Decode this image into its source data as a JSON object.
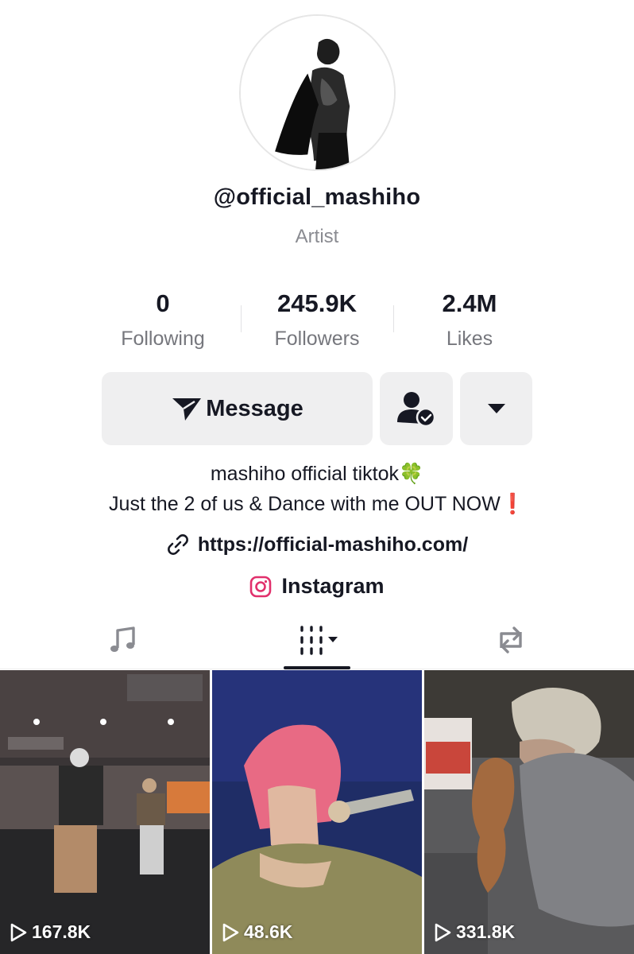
{
  "profile": {
    "username": "@official_mashiho",
    "category": "Artist"
  },
  "stats": [
    {
      "value": "0",
      "label": "Following"
    },
    {
      "value": "245.9K",
      "label": "Followers"
    },
    {
      "value": "2.4M",
      "label": "Likes"
    }
  ],
  "actions": {
    "message_label": "Message"
  },
  "bio": {
    "line1": "mashiho official tiktok🍀",
    "line2": "Just the 2 of us & Dance with me OUT NOW❗"
  },
  "link": {
    "url": "https://official-mashiho.com/"
  },
  "instagram": {
    "label": "Instagram"
  },
  "tabs": [
    {
      "icon": "music-note-icon"
    },
    {
      "icon": "grid-videos-icon",
      "active": true
    },
    {
      "icon": "repost-icon"
    }
  ],
  "videos": [
    {
      "views": "167.8K"
    },
    {
      "views": "48.6K"
    },
    {
      "views": "331.8K"
    }
  ],
  "colors": {
    "text": "#161823",
    "muted": "#8a8b91",
    "button_bg": "#efeff0",
    "instagram": "#e1306c"
  }
}
